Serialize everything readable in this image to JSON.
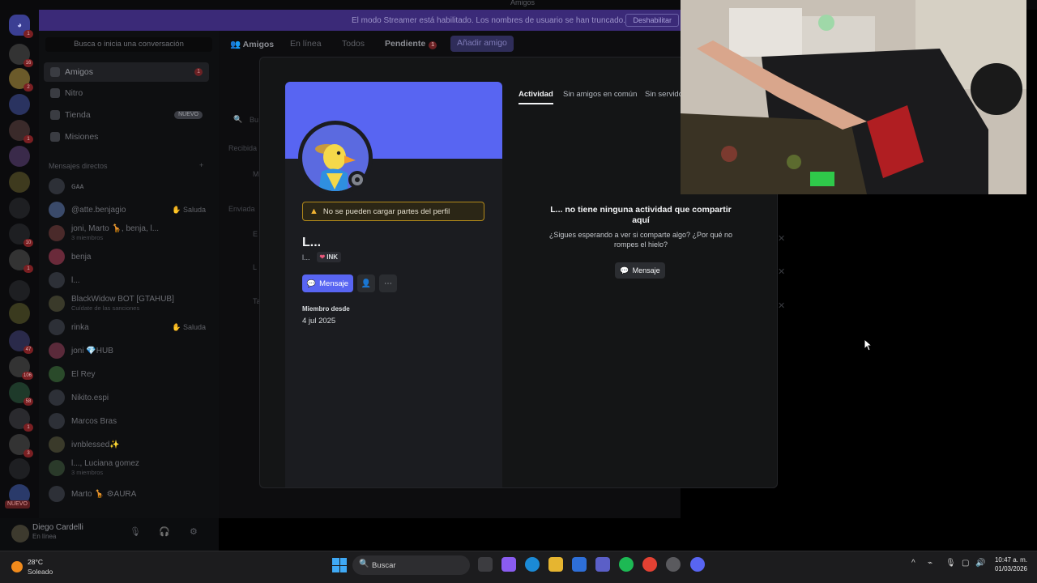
{
  "window": {
    "title": "Amigos"
  },
  "streamer_banner": {
    "message": "El modo Streamer está habilitado. Los nombres de usuario se han truncado.",
    "button": "Deshabilitar"
  },
  "sidebar": {
    "search_label": "Busca o inicia una conversación",
    "nav": [
      {
        "label": "Amigos",
        "badge": "1"
      },
      {
        "label": "Nitro"
      },
      {
        "label": "Tienda",
        "badge": "NUEVO"
      },
      {
        "label": "Misiones"
      }
    ],
    "dm_header": "Mensajes directos",
    "dms": [
      {
        "name": "ɢᴀᴀ",
        "sub": ""
      },
      {
        "name": "@atte.benjagio",
        "sub": "",
        "action": "Saluda"
      },
      {
        "name": "joni, Marto 🦒, benja, l...",
        "sub": "3 miembros"
      },
      {
        "name": "benja",
        "sub": ""
      },
      {
        "name": "l...",
        "sub": ""
      },
      {
        "name": "BlackWidow BOT [GTAHUB]",
        "sub": "Cuídate de las sanciones"
      },
      {
        "name": "rinka",
        "sub": "",
        "action": "Saluda"
      },
      {
        "name": "joni 💎HUB",
        "sub": ""
      },
      {
        "name": "El Rey",
        "sub": ""
      },
      {
        "name": "Nikito.espi",
        "sub": ""
      },
      {
        "name": "Marcos Bras",
        "sub": ""
      },
      {
        "name": "ivnblessed✨",
        "sub": ""
      },
      {
        "name": "l..., Luciana gomez",
        "sub": "3 miembros"
      },
      {
        "name": "Marto 🦒 ⚙AURA",
        "sub": ""
      }
    ]
  },
  "user_panel": {
    "name": "Diego Cardelli",
    "status": "En línea"
  },
  "friends_header": {
    "title": "Amigos",
    "tabs": [
      "En línea",
      "Todos",
      "Pendiente"
    ],
    "pending_count": "1",
    "add_friend": "Añadir amigo"
  },
  "friends_bg": {
    "search_placeholder": "Bu",
    "received": "Recibida",
    "sent": "Enviada",
    "rows": [
      "M",
      "E",
      "L",
      "Ta"
    ]
  },
  "profile": {
    "warning": "No se pueden cargar partes del perfil",
    "display_name": "L...",
    "username": "l...",
    "tag": "INK",
    "message_button": "Mensaje",
    "member_since_label": "Miembro desde",
    "member_since_value": "4 jul 2025",
    "tabs": [
      "Actividad",
      "Sin amigos en común",
      "Sin servido"
    ],
    "empty_title": "L... no tiene ninguna actividad que compartir aquí",
    "empty_subtitle": "¿Sigues esperando a ver si comparte algo? ¿Por qué no rompes el hielo?",
    "empty_button": "Mensaje"
  },
  "rail_badges": [
    "1",
    "16",
    "2",
    "1",
    "10",
    "1",
    "47",
    "106",
    "58",
    "1",
    "3",
    "NUEVO"
  ],
  "taskbar": {
    "weather_temp": "28°C",
    "weather_cond": "Soleado",
    "search": "Buscar",
    "time": "10:47 a. m.",
    "date": "01/03/2026"
  },
  "colors": {
    "blurple": "#5865f2",
    "warning": "#f0b232",
    "danger_badge": "#6b2124"
  }
}
